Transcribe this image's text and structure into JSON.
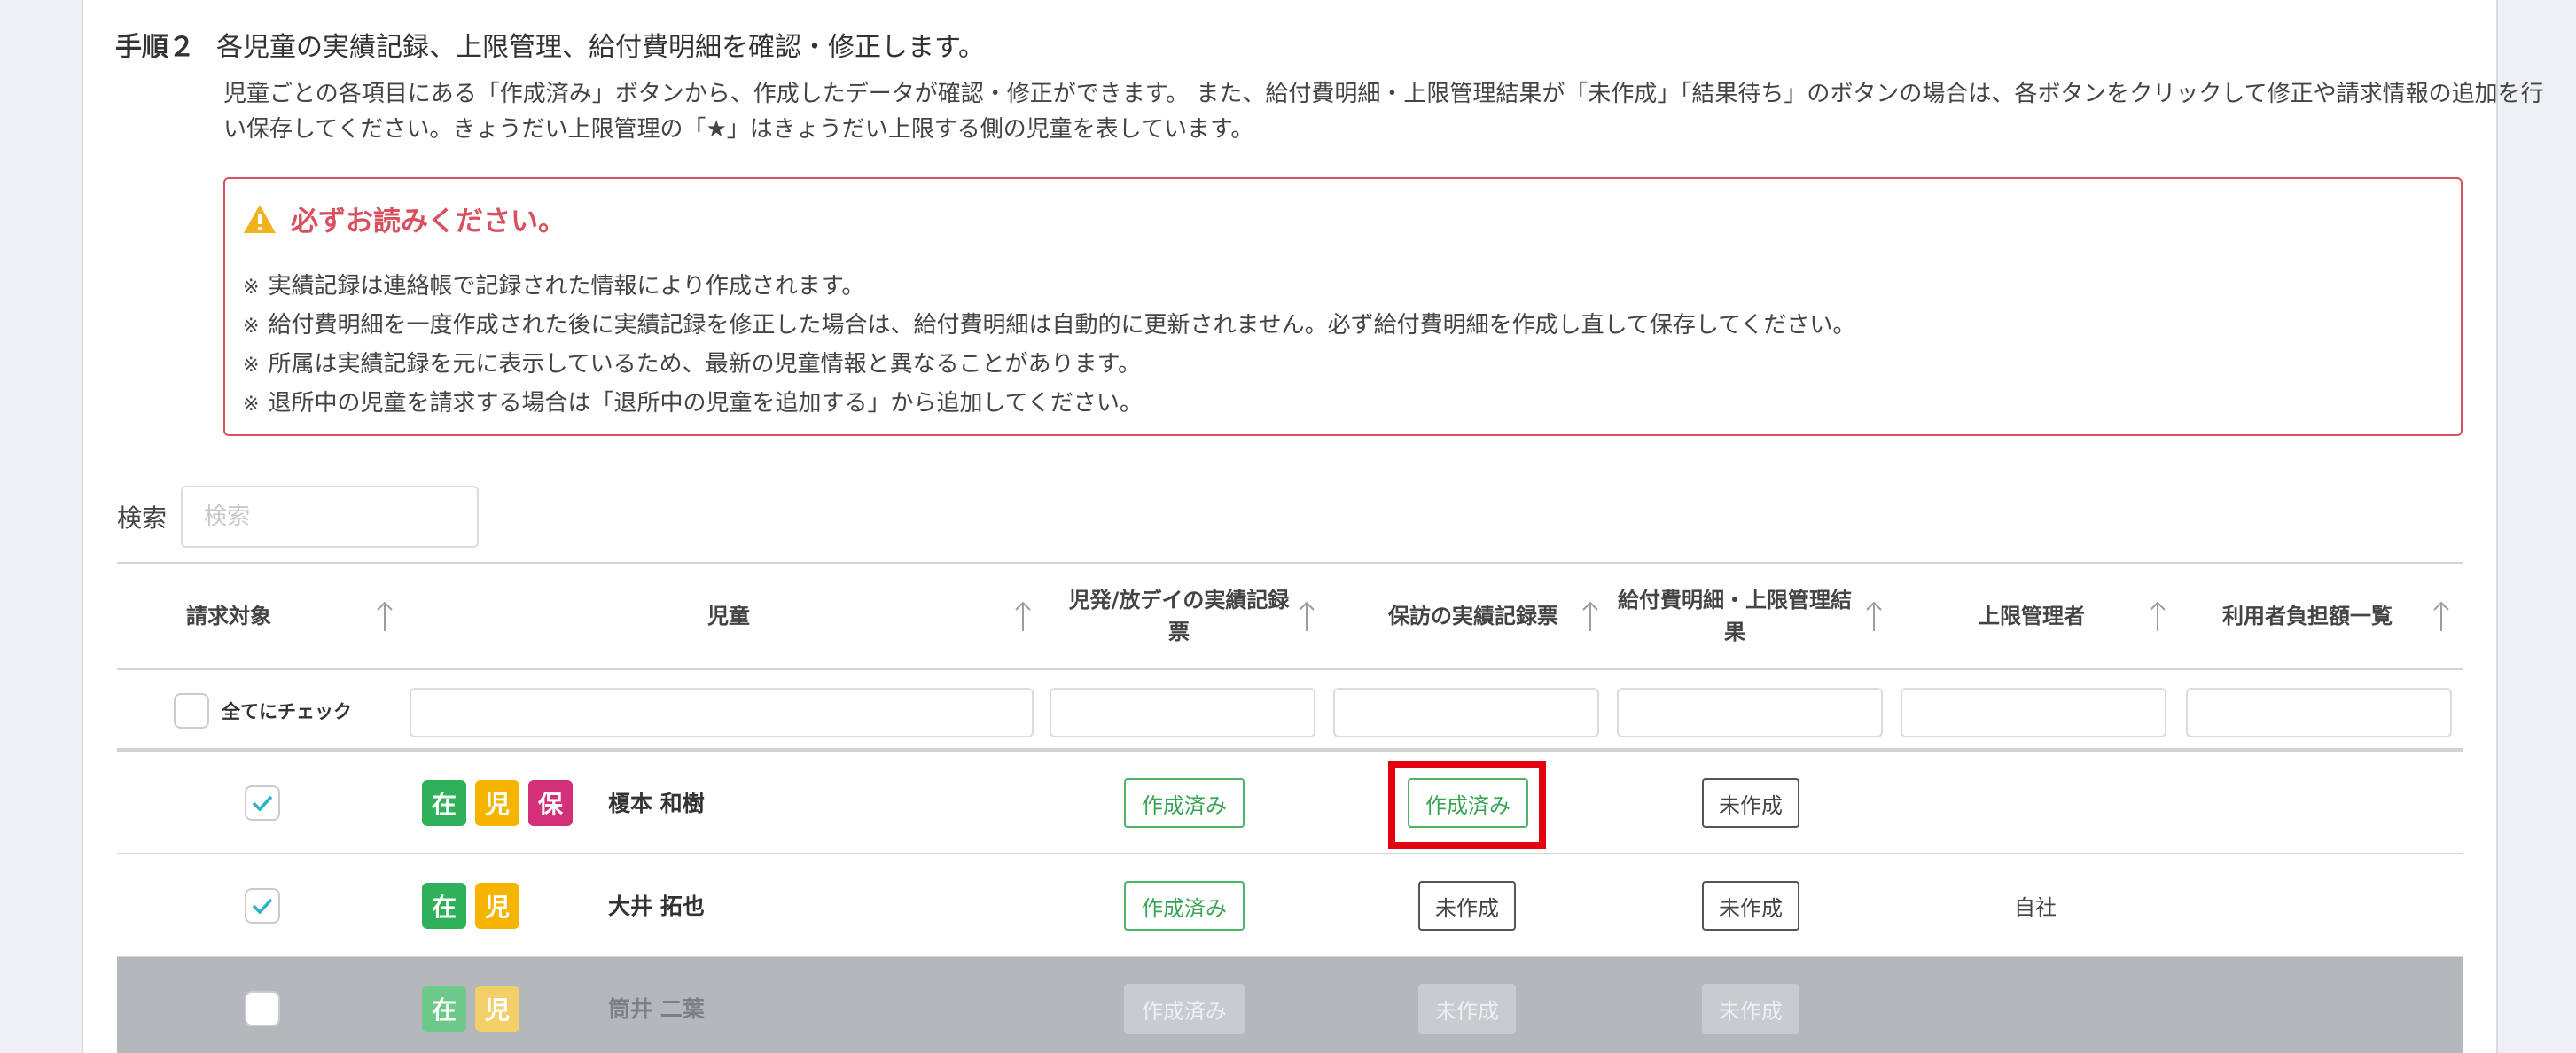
{
  "step": {
    "label": "手順２",
    "title": "各児童の実績記録、上限管理、給付費明細を確認・修正します。",
    "desc": "児童ごとの各項目にある「作成済み」ボタンから、作成したデータが確認・修正ができます。 また、給付費明細・上限管理結果が「未作成」「結果待ち」のボタンの場合は、各ボタンをクリックして修正や請求情報の追加を行い保存してください。きょうだい上限管理の「★」はきょうだい上限する側の児童を表しています。"
  },
  "notice": {
    "title": "必ずお読みください。",
    "mark": "※",
    "items": [
      "実績記録は連絡帳で記録された情報により作成されます。",
      "給付費明細を一度作成された後に実績記録を修正した場合は、給付費明細は自動的に更新されません。必ず給付費明細を作成し直して保存してください。",
      "所属は実績記録を元に表示しているため、最新の児童情報と異なることがあります。",
      "退所中の児童を請求する場合は「退所中の児童を追加する」から追加してください。"
    ]
  },
  "search": {
    "label": "検索",
    "placeholder": "検索"
  },
  "table": {
    "headers": {
      "billing": "請求対象",
      "child": "児童",
      "record": "児発/放デイの実績記録票",
      "visit": "保訪の実績記録票",
      "benefit": "給付費明細・上限管理結果",
      "limit_manager": "上限管理者",
      "burden": "利用者負担額一覧"
    },
    "check_all_label": "全てにチェック",
    "rows": [
      {
        "checked": true,
        "badges": [
          "在",
          "児",
          "保"
        ],
        "name": "榎本 和樹",
        "record": "作成済み",
        "visit": "作成済み",
        "benefit": "未作成",
        "limit_manager": "",
        "disabled": false
      },
      {
        "checked": true,
        "badges": [
          "在",
          "児"
        ],
        "name": "大井 拓也",
        "record": "作成済み",
        "visit": "未作成",
        "benefit": "未作成",
        "limit_manager": "自社",
        "disabled": false
      },
      {
        "checked": false,
        "badges": [
          "在",
          "児"
        ],
        "name": "筒井 二葉",
        "record": "作成済み",
        "visit": "未作成",
        "benefit": "未作成",
        "limit_manager": "",
        "disabled": true
      }
    ]
  },
  "colors": {
    "badge_zai": "#2fb05a",
    "badge_ji": "#f5b400",
    "badge_ho": "#d4307a",
    "accent_red": "#d9505e",
    "green": "#4fb36a"
  }
}
